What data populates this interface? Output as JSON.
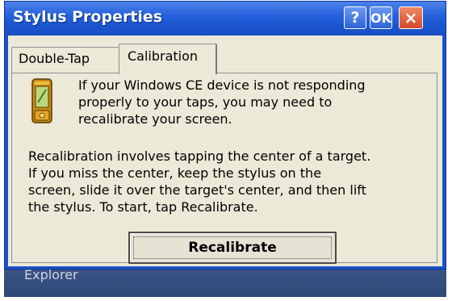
{
  "window": {
    "title": "Stylus Properties",
    "buttons": {
      "help_label": "?",
      "ok_label": "OK",
      "close_label": "×"
    },
    "icon": "pda-device-icon"
  },
  "tabs": [
    {
      "label": "Double-Tap",
      "active": false
    },
    {
      "label": "Calibration",
      "active": true
    }
  ],
  "calibration": {
    "intro_lines": [
      "If your Windows CE device is not responding",
      "properly to your taps, you may need to",
      "recalibrate your screen."
    ],
    "body_lines": [
      "Recalibration involves tapping the center of a target.",
      "If you miss the center, keep the stylus on the",
      "screen, slide it over the target's center, and then lift",
      "the stylus. To start, tap Recalibrate."
    ],
    "recalibrate_label": "Recalibrate"
  },
  "desktop": {
    "background_label": "Explorer"
  },
  "colors": {
    "titlebar": "#2562dc",
    "client": "#ece9d8",
    "close": "#d5472a",
    "taskbar": "#34507f"
  }
}
